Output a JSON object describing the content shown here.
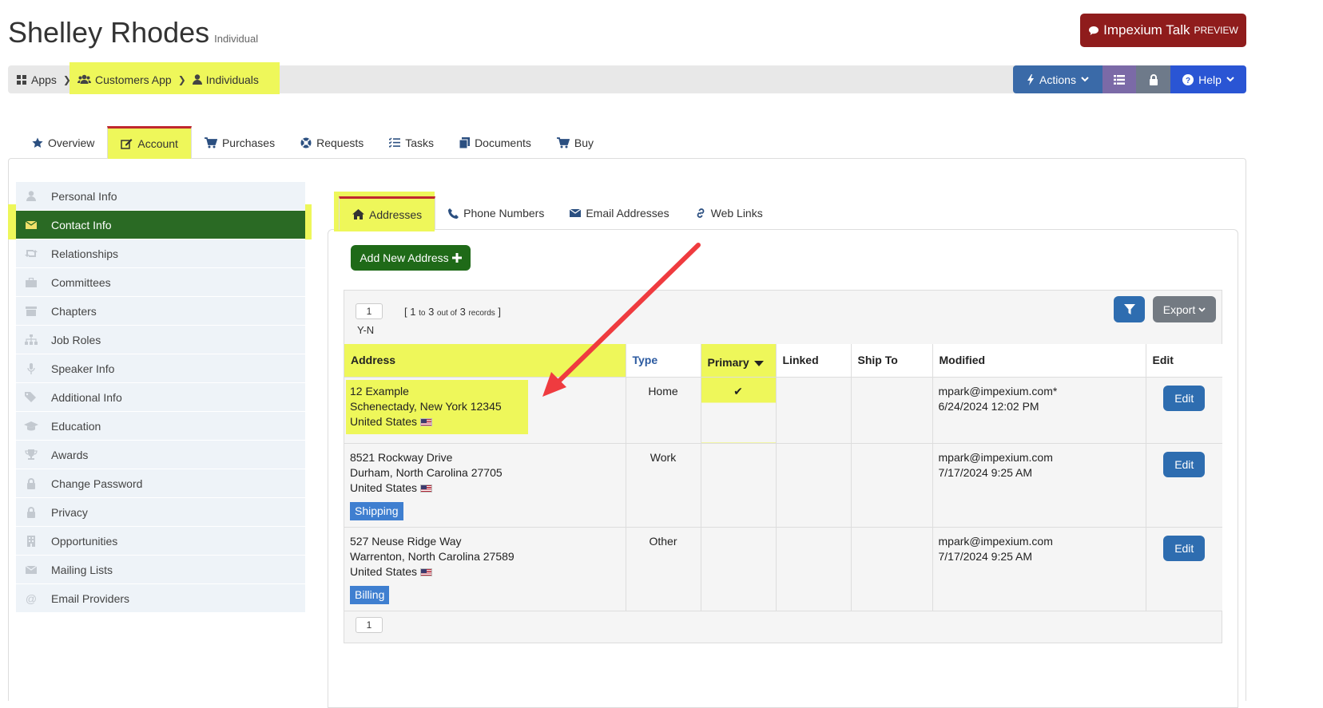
{
  "header": {
    "name": "Shelley Rhodes",
    "subtitle": "Individual",
    "talk_label": "Impexium Talk",
    "talk_badge": "PREVIEW"
  },
  "breadcrumb": [
    {
      "label": "Apps",
      "icon": "grid-icon"
    },
    {
      "label": "Customers App",
      "icon": "users-icon"
    },
    {
      "label": "Individuals",
      "icon": "user-icon"
    }
  ],
  "toolbar": {
    "actions_label": "Actions",
    "help_label": "Help",
    "colors": {
      "actions": "#3a6aa8",
      "list": "#7b6aa7",
      "lock": "#6e7a8a",
      "help": "#2a55d4"
    }
  },
  "main_tabs": [
    {
      "label": "Overview",
      "icon": "star-icon"
    },
    {
      "label": "Account",
      "icon": "edit-icon",
      "active": true
    },
    {
      "label": "Purchases",
      "icon": "cart-icon"
    },
    {
      "label": "Requests",
      "icon": "lifebuoy-icon"
    },
    {
      "label": "Tasks",
      "icon": "tasks-icon"
    },
    {
      "label": "Documents",
      "icon": "documents-icon"
    },
    {
      "label": "Buy",
      "icon": "cart-icon"
    }
  ],
  "side_menu": [
    {
      "label": "Personal Info",
      "icon": "user-icon"
    },
    {
      "label": "Contact Info",
      "icon": "envelope-icon",
      "active": true
    },
    {
      "label": "Relationships",
      "icon": "retweet-icon"
    },
    {
      "label": "Committees",
      "icon": "briefcase-icon"
    },
    {
      "label": "Chapters",
      "icon": "archive-icon"
    },
    {
      "label": "Job Roles",
      "icon": "sitemap-icon"
    },
    {
      "label": "Speaker Info",
      "icon": "microphone-icon"
    },
    {
      "label": "Additional Info",
      "icon": "tags-icon"
    },
    {
      "label": "Education",
      "icon": "graduation-cap-icon"
    },
    {
      "label": "Awards",
      "icon": "trophy-icon"
    },
    {
      "label": "Change Password",
      "icon": "lock-icon"
    },
    {
      "label": "Privacy",
      "icon": "lock-icon"
    },
    {
      "label": "Opportunities",
      "icon": "building-icon"
    },
    {
      "label": "Mailing Lists",
      "icon": "envelope-icon"
    },
    {
      "label": "Email Providers",
      "icon": "at-icon"
    }
  ],
  "sub_tabs": [
    {
      "label": "Addresses",
      "icon": "home-icon",
      "active": true
    },
    {
      "label": "Phone Numbers",
      "icon": "phone-icon"
    },
    {
      "label": "Email Addresses",
      "icon": "envelope-icon"
    },
    {
      "label": "Web Links",
      "icon": "link-icon"
    }
  ],
  "add_button_label": "Add New Address",
  "grid": {
    "page": "1",
    "range_open": "[ 1",
    "range_to": "to",
    "range_mid": "3",
    "range_out_of": "out of",
    "range_total": "3",
    "range_records": "records",
    "range_close": "]",
    "filter_note": "Y-N",
    "export_label": "Export",
    "columns": [
      "Address",
      "Type",
      "Primary",
      "Linked",
      "Ship To",
      "Modified",
      "Edit"
    ],
    "rows": [
      {
        "line1": "12 Example",
        "line2": "Schenectady, New York 12345",
        "country": "United States",
        "tag": "",
        "type": "Home",
        "primary": "✔",
        "linked": "",
        "ship_to": "",
        "modified_by": "mpark@impexium.com*",
        "modified_at": "6/24/2024 12:02 PM",
        "edit": "Edit"
      },
      {
        "line1": "8521 Rockway Drive",
        "line2": "Durham, North Carolina 27705",
        "country": "United States",
        "tag": "Shipping",
        "type": "Work",
        "primary": "",
        "linked": "",
        "ship_to": "",
        "modified_by": "mpark@impexium.com",
        "modified_at": "7/17/2024 9:25 AM",
        "edit": "Edit"
      },
      {
        "line1": "527 Neuse Ridge Way",
        "line2": "Warrenton, North Carolina 27589",
        "country": "United States",
        "tag": "Billing",
        "type": "Other",
        "primary": "",
        "linked": "",
        "ship_to": "",
        "modified_by": "mpark@impexium.com",
        "modified_at": "7/17/2024 9:25 AM",
        "edit": "Edit"
      }
    ]
  },
  "colors": {
    "highlight": "#eef75a",
    "annotation_arrow": "#ef3b3f",
    "active_green": "#2a6a24",
    "talk": "#8f1c1c"
  }
}
